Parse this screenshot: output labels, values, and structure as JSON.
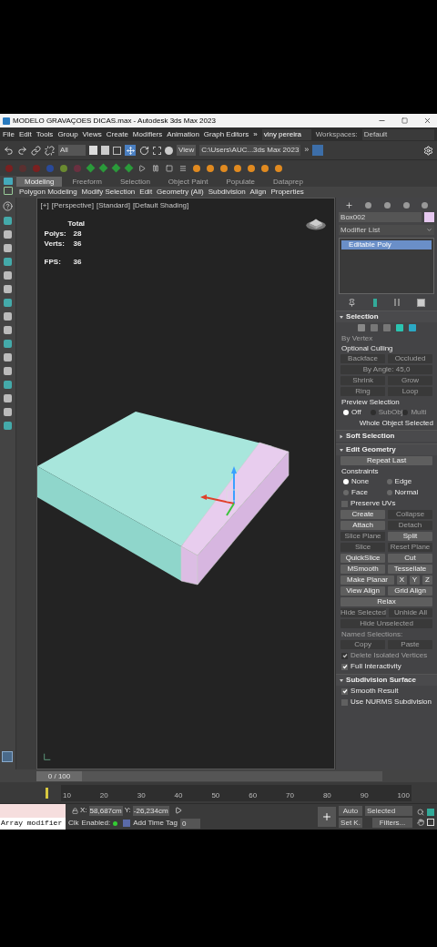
{
  "title_bar": {
    "title": "MODELO GRAVAÇOES DICAS.max - Autodesk 3ds Max 2023"
  },
  "menu": [
    "File",
    "Edit",
    "Tools",
    "Group",
    "Views",
    "Create",
    "Modifiers",
    "Animation",
    "Graph Editors",
    "»"
  ],
  "account": {
    "user": "viny pereira",
    "workspaces_label": "Workspaces:",
    "workspace": "Default"
  },
  "toolbar": {
    "filter": "All",
    "view": "View",
    "path": "C:\\Users\\AUC...3ds Max 2023",
    "more": "»"
  },
  "ribbon_tabs": [
    {
      "label": "Modeling",
      "selected": true
    },
    {
      "label": "Freeform",
      "selected": false
    },
    {
      "label": "Selection",
      "selected": false
    },
    {
      "label": "Object Paint",
      "selected": false
    },
    {
      "label": "Populate",
      "selected": false
    },
    {
      "label": "Dataprep",
      "selected": false
    }
  ],
  "ribbon_items": [
    "Polygon Modeling",
    "Modify Selection",
    "Edit",
    "Geometry (All)",
    "Subdivision",
    "Align",
    "Properties"
  ],
  "viewport": {
    "labels": [
      "[+]",
      "[Perspective]",
      "[Standard]",
      "[Default Shading]"
    ],
    "stats_header": "Total",
    "stats": [
      {
        "label": "Polys:",
        "value": "28"
      },
      {
        "label": "Verts:",
        "value": "36"
      },
      {
        "label": "FPS:",
        "value": "36"
      }
    ]
  },
  "command_panel": {
    "object_name": "Box002",
    "modifier_list": "Modifier List",
    "stack": [
      {
        "label": "Editable Poly",
        "selected": true
      }
    ],
    "rollouts": [
      {
        "title": "Selection",
        "expanded": true,
        "rows": [
          {
            "kind": "icons"
          },
          {
            "kind": "label",
            "text": "By Vertex",
            "disabled": true
          },
          {
            "kind": "label",
            "text": "Optional Culling",
            "disabled": false
          },
          {
            "kind": "buttons",
            "items": [
              {
                "label": "Backface",
                "disabled": true
              },
              {
                "label": "Occluded",
                "disabled": true
              }
            ]
          },
          {
            "kind": "buttons",
            "items": [
              {
                "label": "By Angle: 45,0",
                "disabled": true
              }
            ]
          },
          {
            "kind": "buttons",
            "items": [
              {
                "label": "Shrink",
                "disabled": true
              },
              {
                "label": "Grow",
                "disabled": true
              }
            ]
          },
          {
            "kind": "buttons",
            "items": [
              {
                "label": "Ring",
                "disabled": true
              },
              {
                "label": "Loop",
                "disabled": true
              }
            ]
          },
          {
            "kind": "label",
            "text": "Preview Selection",
            "disabled": false
          },
          {
            "kind": "radios",
            "items": [
              {
                "label": "Off",
                "selected": true,
                "disabled": false
              },
              {
                "label": "SubObj",
                "selected": false,
                "disabled": true
              },
              {
                "label": "Multi",
                "selected": false,
                "disabled": true
              }
            ]
          },
          {
            "kind": "note",
            "text": "Whole Object Selected",
            "disabled": false
          }
        ]
      },
      {
        "title": "Soft Selection",
        "expanded": false
      },
      {
        "title": "Edit Geometry",
        "expanded": true,
        "rows": [
          {
            "kind": "buttons",
            "items": [
              {
                "label": "Repeat Last",
                "disabled": false
              }
            ]
          },
          {
            "kind": "label",
            "text": "Constraints",
            "disabled": false
          },
          {
            "kind": "radios",
            "items": [
              {
                "label": "None",
                "selected": true,
                "disabled": false
              },
              {
                "label": "Edge",
                "selected": false,
                "disabled": false
              }
            ]
          },
          {
            "kind": "radios",
            "items": [
              {
                "label": "Face",
                "selected": false,
                "disabled": false
              },
              {
                "label": "Normal",
                "selected": false,
                "disabled": false
              }
            ]
          },
          {
            "kind": "check",
            "label": "Preserve UVs",
            "checked": false,
            "disabled": false
          },
          {
            "kind": "buttons",
            "items": [
              {
                "label": "Create",
                "disabled": false
              },
              {
                "label": "Collapse",
                "disabled": true
              }
            ]
          },
          {
            "kind": "buttons",
            "items": [
              {
                "label": "Attach",
                "disabled": false
              },
              {
                "label": "Detach",
                "disabled": true
              }
            ]
          },
          {
            "kind": "buttons",
            "items": [
              {
                "label": "Slice Plane",
                "disabled": true
              },
              {
                "label": "Split",
                "disabled": false
              }
            ]
          },
          {
            "kind": "buttons",
            "items": [
              {
                "label": "Slice",
                "disabled": true
              },
              {
                "label": "Reset Plane",
                "disabled": true
              }
            ]
          },
          {
            "kind": "buttons",
            "items": [
              {
                "label": "QuickSlice",
                "disabled": false
              },
              {
                "label": "Cut",
                "disabled": false
              }
            ]
          },
          {
            "kind": "buttons",
            "items": [
              {
                "label": "MSmooth",
                "disabled": false
              },
              {
                "label": "Tessellate",
                "disabled": false
              }
            ]
          },
          {
            "kind": "buttons",
            "items": [
              {
                "label": "Make Planar",
                "disabled": false
              },
              {
                "label": "X",
                "disabled": false
              },
              {
                "label": "Y",
                "disabled": false
              },
              {
                "label": "Z",
                "disabled": false
              }
            ]
          },
          {
            "kind": "buttons",
            "items": [
              {
                "label": "View Align",
                "disabled": false
              },
              {
                "label": "Grid Align",
                "disabled": false
              }
            ]
          },
          {
            "kind": "buttons",
            "items": [
              {
                "label": "Relax",
                "disabled": false
              }
            ]
          },
          {
            "kind": "buttons",
            "items": [
              {
                "label": "Hide Selected",
                "disabled": true
              },
              {
                "label": "Unhide All",
                "disabled": true
              }
            ]
          },
          {
            "kind": "buttons",
            "items": [
              {
                "label": "Hide Unselected",
                "disabled": true
              }
            ]
          },
          {
            "kind": "label",
            "text": "Named Selections:",
            "disabled": true
          },
          {
            "kind": "buttons",
            "items": [
              {
                "label": "Copy",
                "disabled": true
              },
              {
                "label": "Paste",
                "disabled": true
              }
            ]
          },
          {
            "kind": "check",
            "label": "Delete Isolated Vertices",
            "checked": true,
            "disabled": true
          },
          {
            "kind": "check",
            "label": "Full Interactivity",
            "checked": true,
            "disabled": false
          }
        ]
      },
      {
        "title": "Subdivision Surface",
        "expanded": true,
        "rows": [
          {
            "kind": "check",
            "label": "Smooth Result",
            "checked": true,
            "disabled": false
          },
          {
            "kind": "check",
            "label": "Use NURMS Subdivision",
            "checked": false,
            "disabled": false
          }
        ]
      }
    ]
  },
  "timeline": {
    "frame": "0 / 100",
    "level": 0,
    "ticks": [
      "10",
      "20",
      "30",
      "40",
      "50",
      "60",
      "70",
      "80",
      "90",
      "100"
    ]
  },
  "status": {
    "prompt": "Array modifier",
    "x_label": "X:",
    "x": "58,687cm",
    "y_label": "Y:",
    "y": "-26,234cm",
    "clk": "Clk",
    "enabled": "Enabled:",
    "add_time_tag": "Add Time Tag",
    "frame_field": "0",
    "auto": "Auto",
    "set_key": "Set K.",
    "key_filter": "Selected",
    "filters": "Filters..."
  }
}
